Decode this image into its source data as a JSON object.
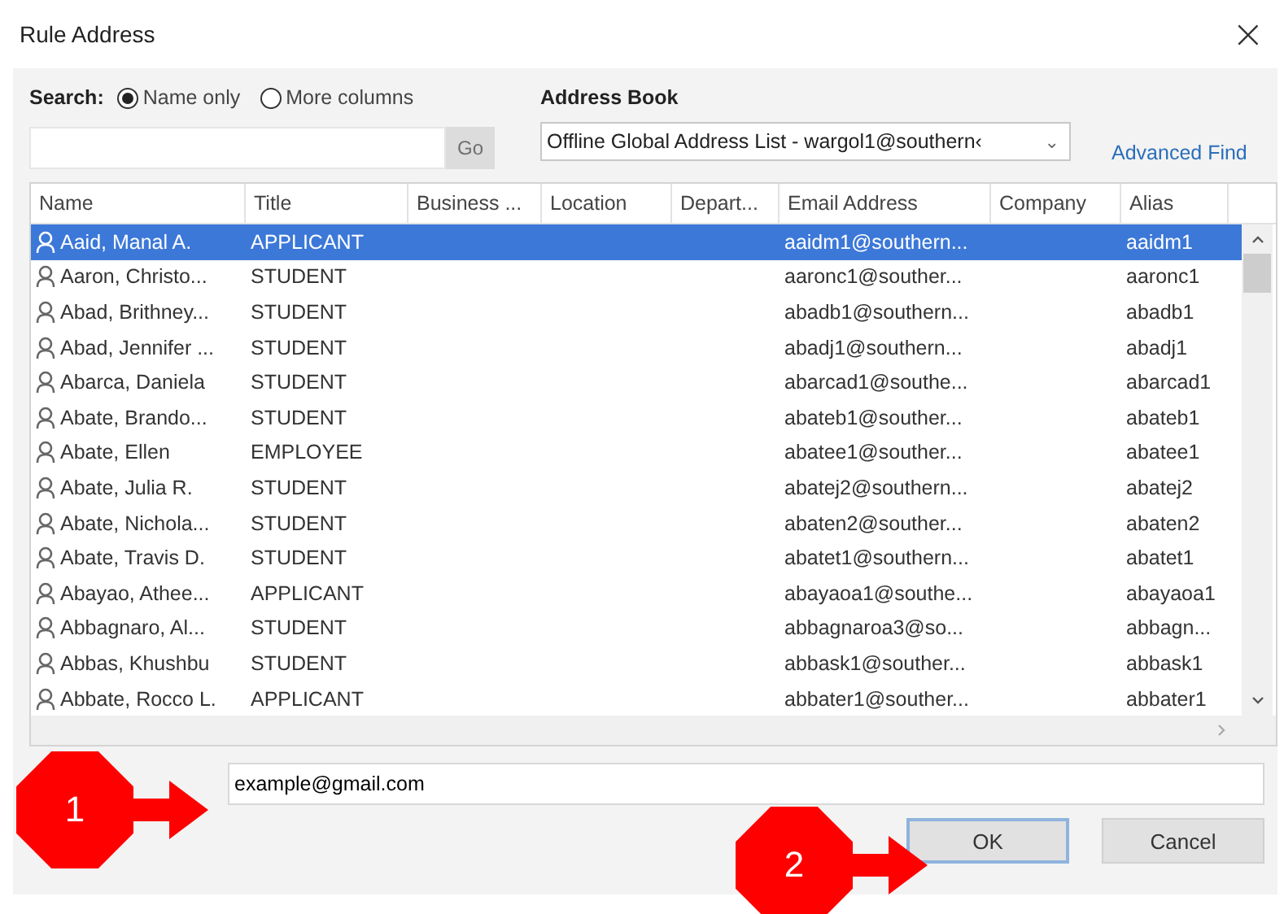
{
  "window": {
    "title": "Rule Address",
    "close": "×"
  },
  "search": {
    "label": "Search:",
    "options": [
      {
        "label": "Name only",
        "selected": true
      },
      {
        "label": "More columns",
        "selected": false
      }
    ],
    "go": "Go"
  },
  "address_book": {
    "label": "Address Book",
    "value": "Offline Global Address List - wargol1@southern‹",
    "caret": "⌄"
  },
  "advanced_find": "Advanced Find",
  "table": {
    "columns": [
      "Name",
      "Title",
      "Business ...",
      "Location",
      "Depart...",
      "Email Address",
      "Company",
      "Alias"
    ],
    "rows": [
      {
        "name": "Aaid, Manal A.",
        "title": "APPLICANT",
        "email": "aaidm1@southern...",
        "alias": "aaidm1",
        "selected": true
      },
      {
        "name": "Aaron, Christo...",
        "title": "STUDENT",
        "email": "aaronc1@souther...",
        "alias": "aaronc1",
        "selected": false
      },
      {
        "name": "Abad, Brithney...",
        "title": "STUDENT",
        "email": "abadb1@southern...",
        "alias": "abadb1",
        "selected": false
      },
      {
        "name": "Abad, Jennifer ...",
        "title": "STUDENT",
        "email": "abadj1@southern...",
        "alias": "abadj1",
        "selected": false
      },
      {
        "name": "Abarca, Daniela",
        "title": "STUDENT",
        "email": "abarcad1@southe...",
        "alias": "abarcad1",
        "selected": false
      },
      {
        "name": "Abate, Brando...",
        "title": "STUDENT",
        "email": "abateb1@souther...",
        "alias": "abateb1",
        "selected": false
      },
      {
        "name": "Abate, Ellen",
        "title": "EMPLOYEE",
        "email": "abatee1@souther...",
        "alias": "abatee1",
        "selected": false
      },
      {
        "name": "Abate, Julia R.",
        "title": "STUDENT",
        "email": "abatej2@southern...",
        "alias": "abatej2",
        "selected": false
      },
      {
        "name": "Abate, Nichola...",
        "title": "STUDENT",
        "email": "abaten2@souther...",
        "alias": "abaten2",
        "selected": false
      },
      {
        "name": "Abate, Travis D.",
        "title": "STUDENT",
        "email": "abatet1@southern...",
        "alias": "abatet1",
        "selected": false
      },
      {
        "name": "Abayao, Athee...",
        "title": "APPLICANT",
        "email": "abayaoa1@southe...",
        "alias": "abayaoa1",
        "selected": false
      },
      {
        "name": "Abbagnaro, Al...",
        "title": "STUDENT",
        "email": "abbagnaroa3@so...",
        "alias": "abbagn...",
        "selected": false
      },
      {
        "name": "Abbas, Khushbu",
        "title": "STUDENT",
        "email": "abbask1@souther...",
        "alias": "abbask1",
        "selected": false
      },
      {
        "name": "Abbate, Rocco L.",
        "title": "APPLICANT",
        "email": "abbater1@souther...",
        "alias": "abbater1",
        "selected": false
      }
    ]
  },
  "recipient": {
    "value": "example@gmail.com"
  },
  "buttons": [
    {
      "label": "OK",
      "kind": "default"
    },
    {
      "label": "Cancel",
      "kind": "normal"
    }
  ],
  "callouts": [
    {
      "number": "1"
    },
    {
      "number": "2"
    }
  ]
}
